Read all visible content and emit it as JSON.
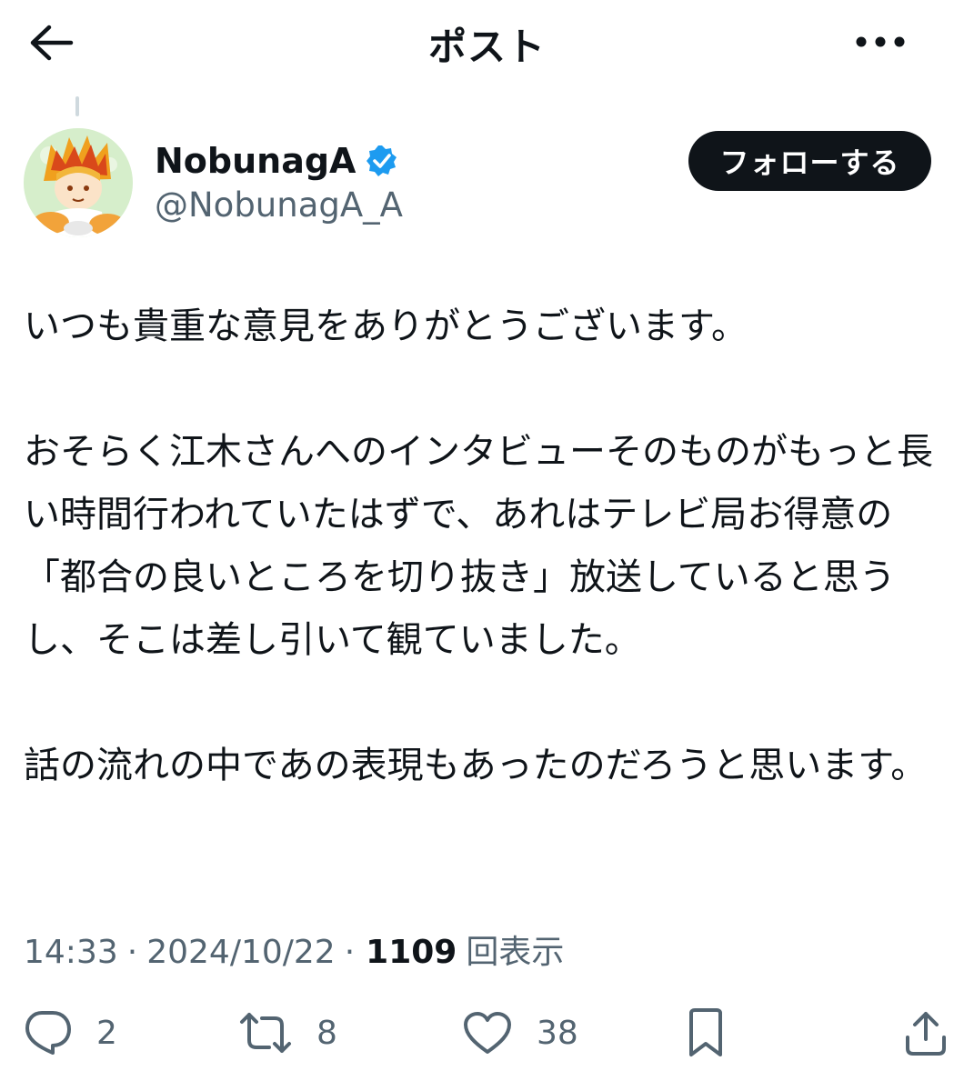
{
  "header": {
    "title": "ポスト",
    "back_icon": "arrow-left-icon",
    "more_icon": "more-horizontal-icon"
  },
  "author": {
    "name": "NobunagA",
    "handle": "@NobunagA_A",
    "verified": true,
    "verified_color": "#1d9bf0",
    "follow_label": "フォローする"
  },
  "post": {
    "paragraphs": [
      "いつも貴重な意見をありがとうございます。",
      "おそらく江木さんへのインタビューそのものがもっと長い時間行われていたはずで、あれはテレビ局お得意の「都合の良いところを切り抜き」放送していると思うし、そこは差し引いて観ていました。",
      "話の流れの中であの表現もあったのだろうと思います。"
    ],
    "time": "14:33",
    "date": "2024/10/22",
    "views_count": "1109",
    "views_label": "回表示",
    "separator": "·"
  },
  "actions": {
    "reply_count": "2",
    "repost_count": "8",
    "like_count": "38",
    "icons": [
      "reply-icon",
      "repost-icon",
      "like-icon",
      "bookmark-icon",
      "share-icon"
    ]
  },
  "colors": {
    "text": "#0f1419",
    "secondary": "#536471",
    "accent": "#1d9bf0",
    "button_bg": "#0f1419"
  }
}
